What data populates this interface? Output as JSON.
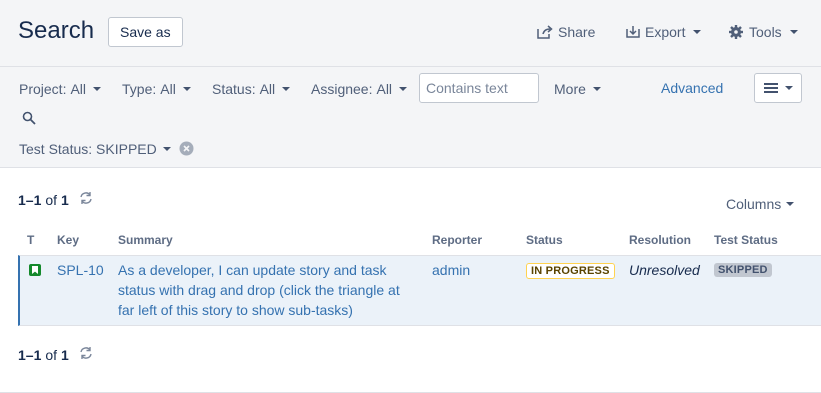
{
  "header": {
    "title": "Search",
    "save_as": "Save as",
    "share": "Share",
    "export": "Export",
    "tools": "Tools"
  },
  "filters": {
    "project": {
      "label": "Project:",
      "value": "All"
    },
    "type": {
      "label": "Type:",
      "value": "All"
    },
    "status": {
      "label": "Status:",
      "value": "All"
    },
    "assignee": {
      "label": "Assignee:",
      "value": "All"
    },
    "text_placeholder": "Contains text",
    "more": "More",
    "advanced": "Advanced",
    "test_status": "Test Status: SKIPPED"
  },
  "results": {
    "range": "1–1",
    "of": "of",
    "total": "1",
    "columns_label": "Columns"
  },
  "table": {
    "headers": {
      "t": "T",
      "key": "Key",
      "summary": "Summary",
      "reporter": "Reporter",
      "status": "Status",
      "resolution": "Resolution",
      "test_status": "Test Status"
    },
    "rows": [
      {
        "key": "SPL-10",
        "summary_lines": [
          "As a developer, I can update story and task",
          "status with drag and drop (click the triangle at",
          "far left of this story to show sub-tasks)"
        ],
        "reporter": "admin",
        "status": "IN PROGRESS",
        "resolution": "Unresolved",
        "test_status": "SKIPPED"
      }
    ]
  }
}
